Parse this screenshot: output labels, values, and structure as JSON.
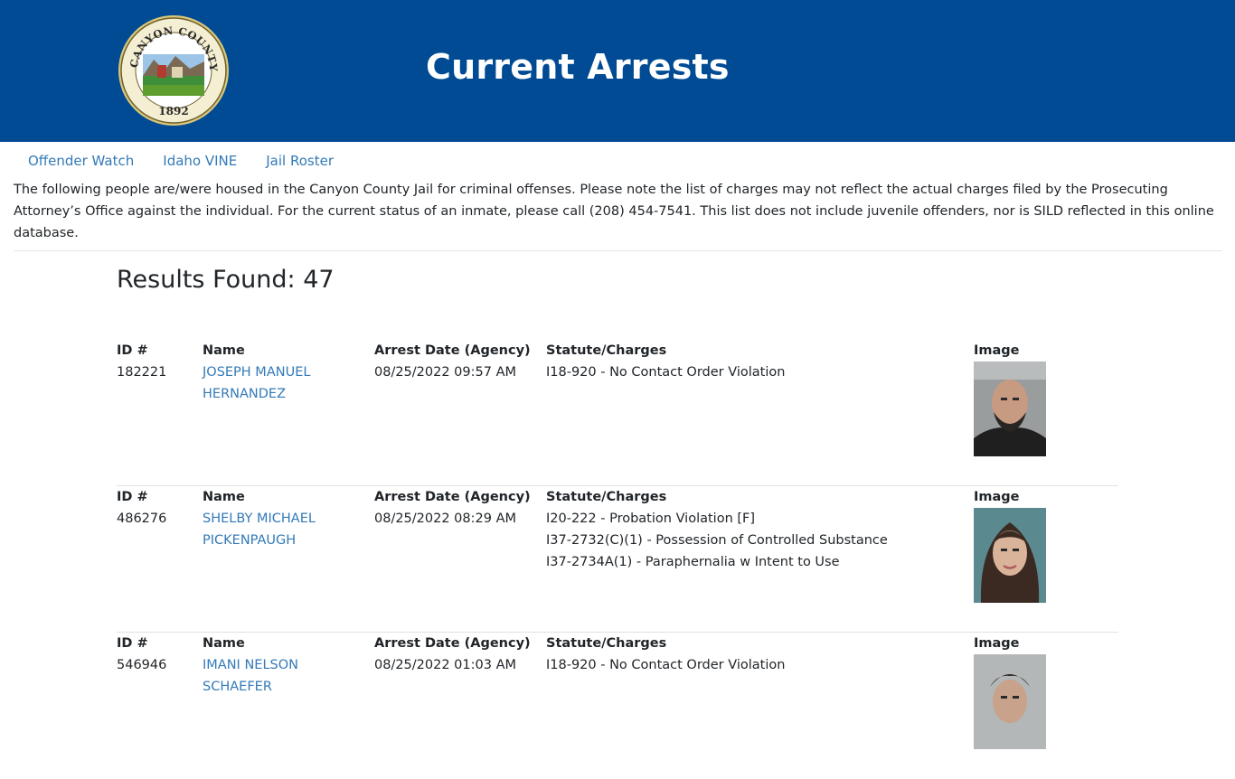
{
  "header": {
    "title": "Current Arrests",
    "seal_text_top": "CANYON COUNTY IDAHO",
    "seal_year": "1892"
  },
  "nav": {
    "items": [
      {
        "label": "Offender Watch"
      },
      {
        "label": "Idaho VINE"
      },
      {
        "label": "Jail Roster"
      }
    ]
  },
  "notice": "The following people are/were housed in the Canyon County Jail for criminal offenses. Please note the list of charges may not reflect the actual charges filed by the Prosecuting Attorney’s Office against the individual. For the current status of an inmate, please call (208) 454-7541. This list does not include juvenile offenders, nor is SILD reflected in this online database.",
  "results": {
    "label": "Results Found: 47"
  },
  "table": {
    "headers": {
      "id": "ID #",
      "name": "Name",
      "date": "Arrest Date (Agency)",
      "charges": "Statute/Charges",
      "image": "Image"
    },
    "records": [
      {
        "id": "182221",
        "name_line1": "JOSEPH MANUEL",
        "name_line2": "HERNANDEZ",
        "date": "08/25/2022 09:57 AM",
        "charges": [
          "I18-920 - No Contact Order Violation"
        ]
      },
      {
        "id": "486276",
        "name_line1": "SHELBY MICHAEL",
        "name_line2": "PICKENPAUGH",
        "date": "08/25/2022 08:29 AM",
        "charges": [
          "I20-222 - Probation Violation [F]",
          "I37-2732(C)(1) - Possession of Controlled Substance",
          "I37-2734A(1) - Paraphernalia w Intent to Use"
        ]
      },
      {
        "id": "546946",
        "name_line1": "IMANI NELSON",
        "name_line2": "SCHAEFER",
        "date": "08/25/2022 01:03 AM",
        "charges": [
          "I18-920 - No Contact Order Violation"
        ]
      }
    ]
  },
  "colors": {
    "banner": "#004b94",
    "link": "#337ab7"
  }
}
